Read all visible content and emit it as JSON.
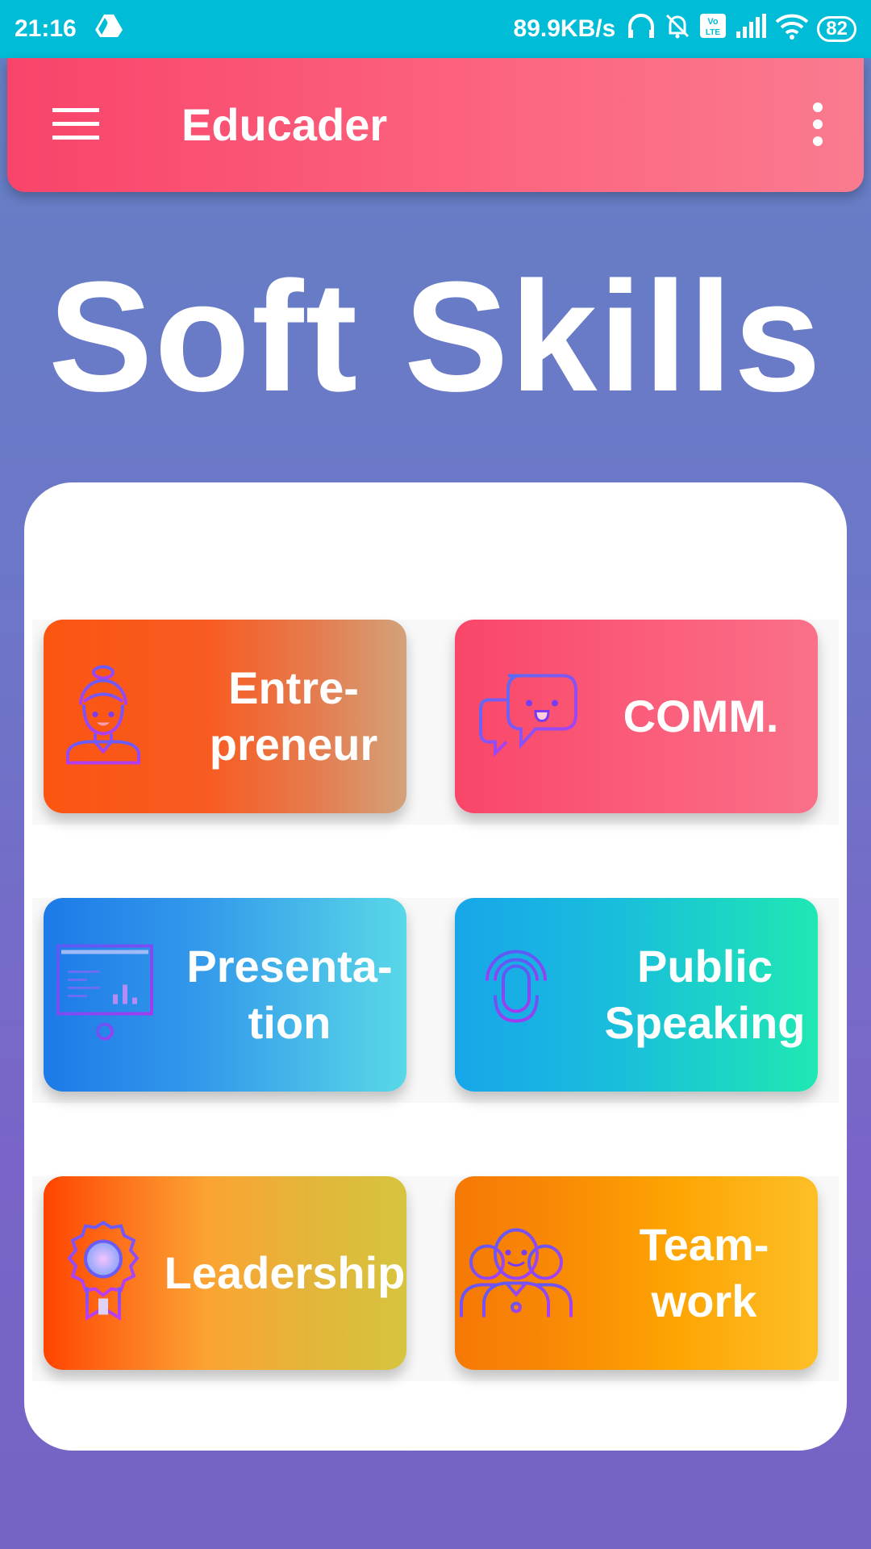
{
  "status_bar": {
    "time": "21:16",
    "speed": "89.9KB/s",
    "battery": "82"
  },
  "app_bar": {
    "title": "Educader"
  },
  "page": {
    "heading": "Soft Skills"
  },
  "tiles": [
    {
      "label": "Entre-\npreneur",
      "icon": "entrepreneur-person-icon"
    },
    {
      "label": "COMM.",
      "icon": "chat-bubbles-icon"
    },
    {
      "label": "Presenta-\ntion",
      "icon": "presentation-board-icon"
    },
    {
      "label": "Public\nSpeaking",
      "icon": "microphone-icon"
    },
    {
      "label": "Leadership",
      "icon": "award-ribbon-icon"
    },
    {
      "label": "Team-\nwork",
      "icon": "team-group-icon"
    }
  ],
  "colors": {
    "status_bar": "#00bcd6",
    "app_bar": "#f9446a",
    "background": "#6d76c8",
    "icon_stroke": "#7a3cf0"
  }
}
